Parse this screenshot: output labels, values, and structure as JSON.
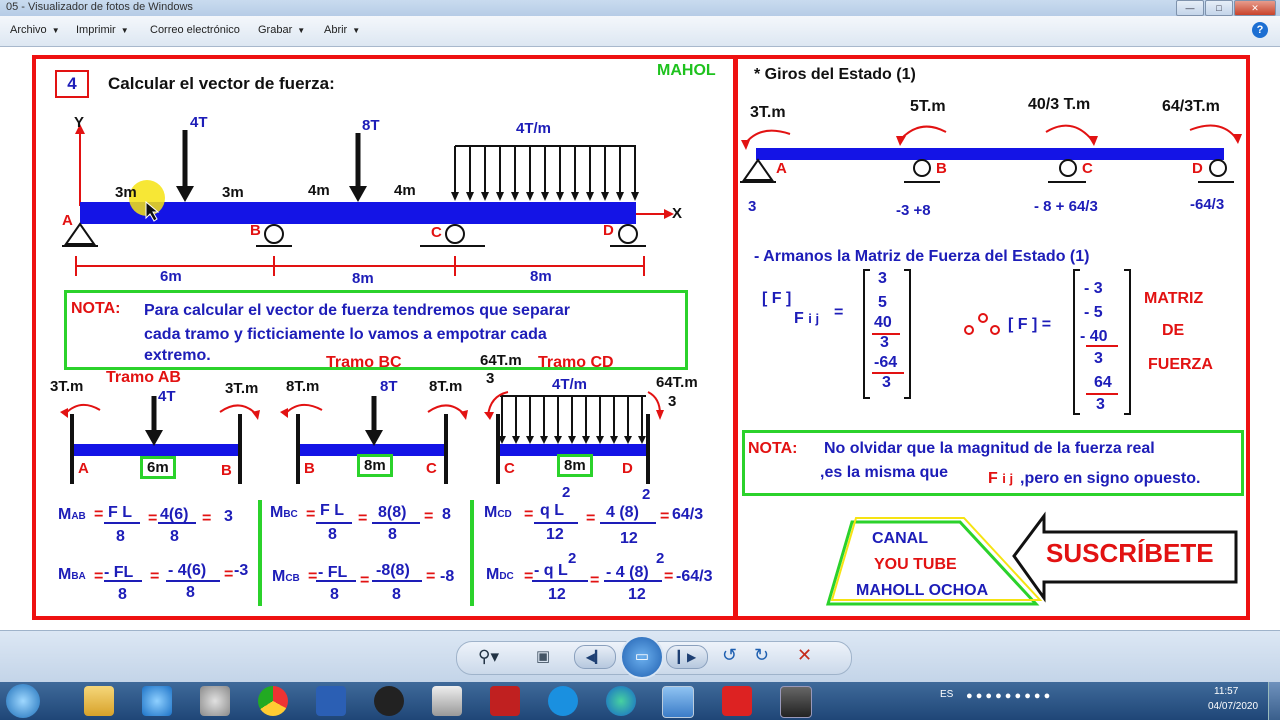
{
  "window": {
    "title": "05 - Visualizador de fotos de Windows"
  },
  "menu": {
    "items": [
      "Archivo",
      "Imprimir",
      "Correo electrónico",
      "Grabar",
      "Abrir"
    ]
  },
  "left": {
    "step": "4",
    "heading": "Calcular  el vector de fuerza:",
    "watermark": "MAHOL",
    "axis_y": "Y",
    "axis_x": "X",
    "loads": {
      "p1": "4T",
      "p2": "8T",
      "dist": "4T/m"
    },
    "dims_top": [
      "3m",
      "3m",
      "4m",
      "4m"
    ],
    "nodes": [
      "A",
      "B",
      "C",
      "D"
    ],
    "dims_bottom": [
      "6m",
      "8m",
      "8m"
    ],
    "nota_label": "NOTA:",
    "nota_lines": [
      "Para calcular el vector  de fuerza tendremos que separar",
      "cada tramo y ficticiamente lo vamos a empotrar cada",
      "extremo."
    ],
    "tramo_ab": {
      "title": "Tramo AB",
      "m_left": "3T.m",
      "m_right": "3T.m",
      "load": "4T",
      "len": "6m",
      "a": "A",
      "b": "B"
    },
    "tramo_bc": {
      "title": "Tramo BC",
      "m_left": "8T.m",
      "m_right": "8T.m",
      "load": "8T",
      "len": "8m",
      "a": "B",
      "b": "C"
    },
    "tramo_cd": {
      "title": "Tramo CD",
      "m_left_num": "64T.m",
      "m_left_den": "3",
      "m_right_num": "64T.m",
      "m_right_den": "3",
      "load": "4T/m",
      "len": "8m",
      "a": "C",
      "b": "D"
    },
    "formulas": {
      "mab": {
        "lbl": "M",
        "sub": "AB",
        "eq1": "=",
        "num1": "F L",
        "den1": "8",
        "eq2": "=",
        "num2": "4(6)",
        "den2": "8",
        "eq3": "=",
        "res": "3"
      },
      "mba": {
        "lbl": "M",
        "sub": "BA",
        "eq1": "=",
        "num1": "- FL",
        "den1": "8",
        "eq2": "=",
        "num2": "- 4(6)",
        "den2": "8",
        "eq3": "=",
        "res": "-3"
      },
      "mbc": {
        "lbl": "M",
        "sub": "BC",
        "eq1": "=",
        "num1": "F L",
        "den1": "8",
        "eq2": "=",
        "num2": "8(8)",
        "den2": "8",
        "eq3": "=",
        "res": "8"
      },
      "mcb": {
        "lbl": "M",
        "sub": "CB",
        "eq1": "=",
        "num1": "- FL",
        "den1": "8",
        "eq2": "=",
        "num2": "-8(8)",
        "den2": "8",
        "eq3": "=",
        "res": "-8"
      },
      "mcd": {
        "lbl": "M",
        "sub": "CD",
        "eq1": "=",
        "num1": "q L",
        "sup1": "2",
        "den1": "12",
        "eq2": "=",
        "num2": "4 (8)",
        "sup2": "2",
        "den2": "12",
        "eq3": "=",
        "res": "64/3"
      },
      "mdc": {
        "lbl": "M",
        "sub": "DC",
        "eq1": "=",
        "num1": "- q L",
        "sup1": "2",
        "den1": "12",
        "eq2": "=",
        "num2": "- 4 (8)",
        "sup2": "2",
        "den2": "12",
        "eq3": "=",
        "res": "-64/3"
      }
    }
  },
  "right": {
    "heading": "* Giros del Estado  (1)",
    "moments": [
      "3T.m",
      "5T.m",
      "40/3 T.m",
      "64/3T.m"
    ],
    "nodes": [
      "A",
      "B",
      "C",
      "D"
    ],
    "values": [
      "3",
      "-3 +8",
      "- 8 + 64/3",
      "-64/3"
    ],
    "matrix_title": "- Armanos la Matriz  de Fuerza del Estado (1)",
    "f_label": "[ F ]",
    "fij": "F",
    "fij_sub": "i j",
    "eq": "=",
    "col1": [
      "3",
      "5",
      "40",
      "3",
      "-64",
      "3"
    ],
    "col2": [
      "- 3",
      "- 5",
      "- 40",
      "3",
      "64",
      "3"
    ],
    "f2_label": "[ F ] =",
    "matriz": [
      "MATRIZ",
      "DE",
      "FUERZA"
    ],
    "nota_label": "NOTA:",
    "nota1": "No olvidar que la magnitud de la fuerza real",
    "nota2a": ",es la misma que",
    "nota2b": "F",
    "nota2sub": "i j",
    "nota2c": ",pero en signo opuesto.",
    "canal": [
      "CANAL",
      "YOU TUBE",
      "MAHOLL OCHOA"
    ],
    "subscribe": "SUSCRÍBETE"
  },
  "taskbar": {
    "lang": "ES",
    "time": "11:57",
    "date": "04/07/2020"
  }
}
